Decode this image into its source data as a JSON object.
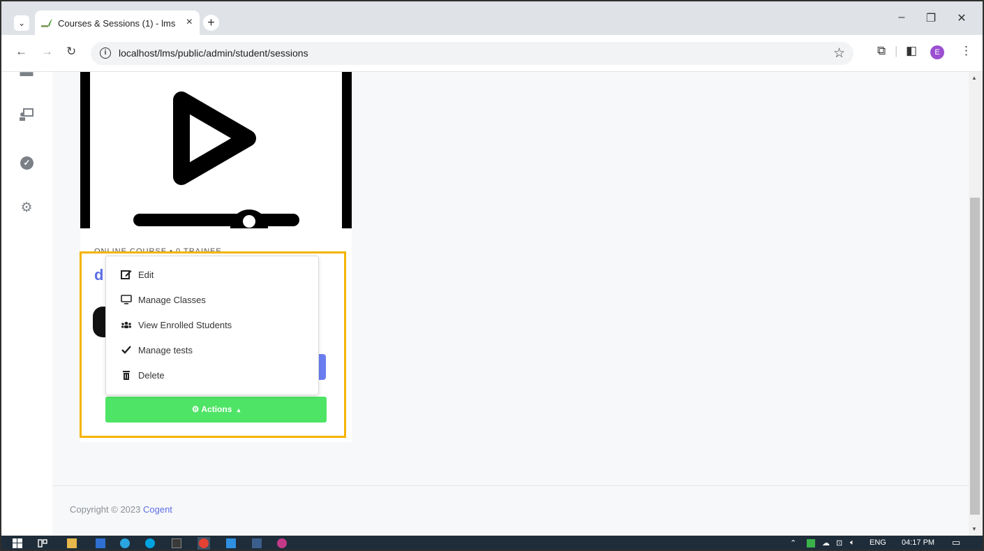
{
  "browser": {
    "tab_title": "Courses & Sessions (1) - lms",
    "tab_close": "×",
    "new_tab": "+",
    "tab_list": "⌄",
    "url": "localhost/lms/public/admin/student/sessions",
    "profile_initial": "E",
    "window_controls": [
      "–",
      "❐",
      "✕"
    ]
  },
  "card": {
    "meta": "ONLINE COURSE  •  0 TRAINEE",
    "title_initial": "d",
    "actions_label": "Actions",
    "actions_caret": "▴"
  },
  "dropdown": {
    "items": [
      {
        "label": "Edit",
        "icon": "edit-icon"
      },
      {
        "label": "Manage Classes",
        "icon": "monitor-icon"
      },
      {
        "label": "View Enrolled Students",
        "icon": "users-icon"
      },
      {
        "label": "Manage tests",
        "icon": "check-icon"
      },
      {
        "label": "Delete",
        "icon": "trash-icon"
      }
    ]
  },
  "footer": {
    "copyright_prefix": "Copyright © 2023 ",
    "copyright_link": "Cogent"
  },
  "taskbar": {
    "language": "ENG",
    "time": "04:17 PM"
  },
  "colors": {
    "accent": "#5b6ee6",
    "actions_green": "#4ee466",
    "highlight": "#f4b400"
  }
}
